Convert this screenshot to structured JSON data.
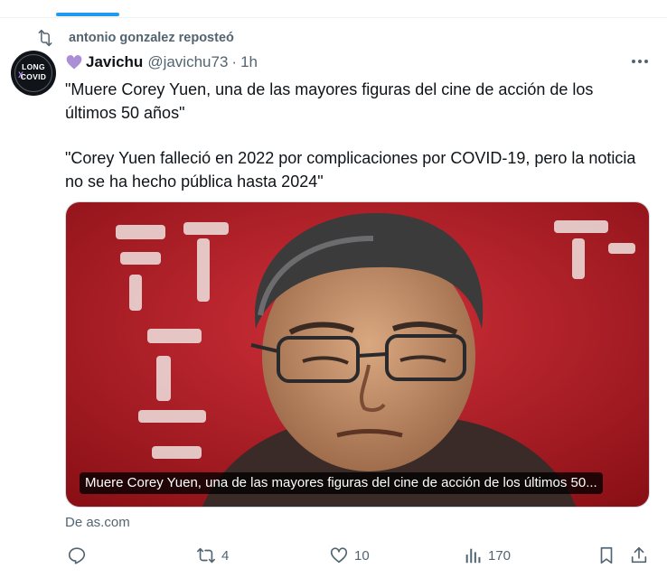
{
  "repost": {
    "icon": "repost-icon",
    "label": "antonio gonzalez reposteó"
  },
  "author": {
    "emoji_icon": "purple-heart-icon",
    "name": "Javichu",
    "handle": "@javichu73",
    "separator": "·",
    "time": "1h",
    "avatar_text_top": "LONG",
    "avatar_text_x": "X",
    "avatar_text_bottom": "COVID"
  },
  "tweet": {
    "paragraph_1": "\"Muere Corey Yuen, una de las mayores figuras del cine de acción de los últimos 50 años\"",
    "paragraph_2": "\"Corey Yuen falleció en 2022 por complicaciones por COVID-19, pero la noticia no se ha hecho pública hasta 2024\""
  },
  "card": {
    "caption": "Muere Corey Yuen, una de las mayores figuras del cine de acción de los últimos 50...",
    "source": "De as.com"
  },
  "actions": {
    "reply": {
      "icon": "reply-icon"
    },
    "retweet": {
      "icon": "retweet-icon",
      "count": "4"
    },
    "like": {
      "icon": "heart-icon",
      "count": "10"
    },
    "views": {
      "icon": "analytics-icon",
      "count": "170"
    },
    "bookmark": {
      "icon": "bookmark-icon"
    },
    "share": {
      "icon": "share-icon"
    }
  },
  "colors": {
    "accent": "#1d9bf0",
    "muted": "#536471",
    "text": "#0f1419",
    "image_bg": "#c4202a"
  }
}
